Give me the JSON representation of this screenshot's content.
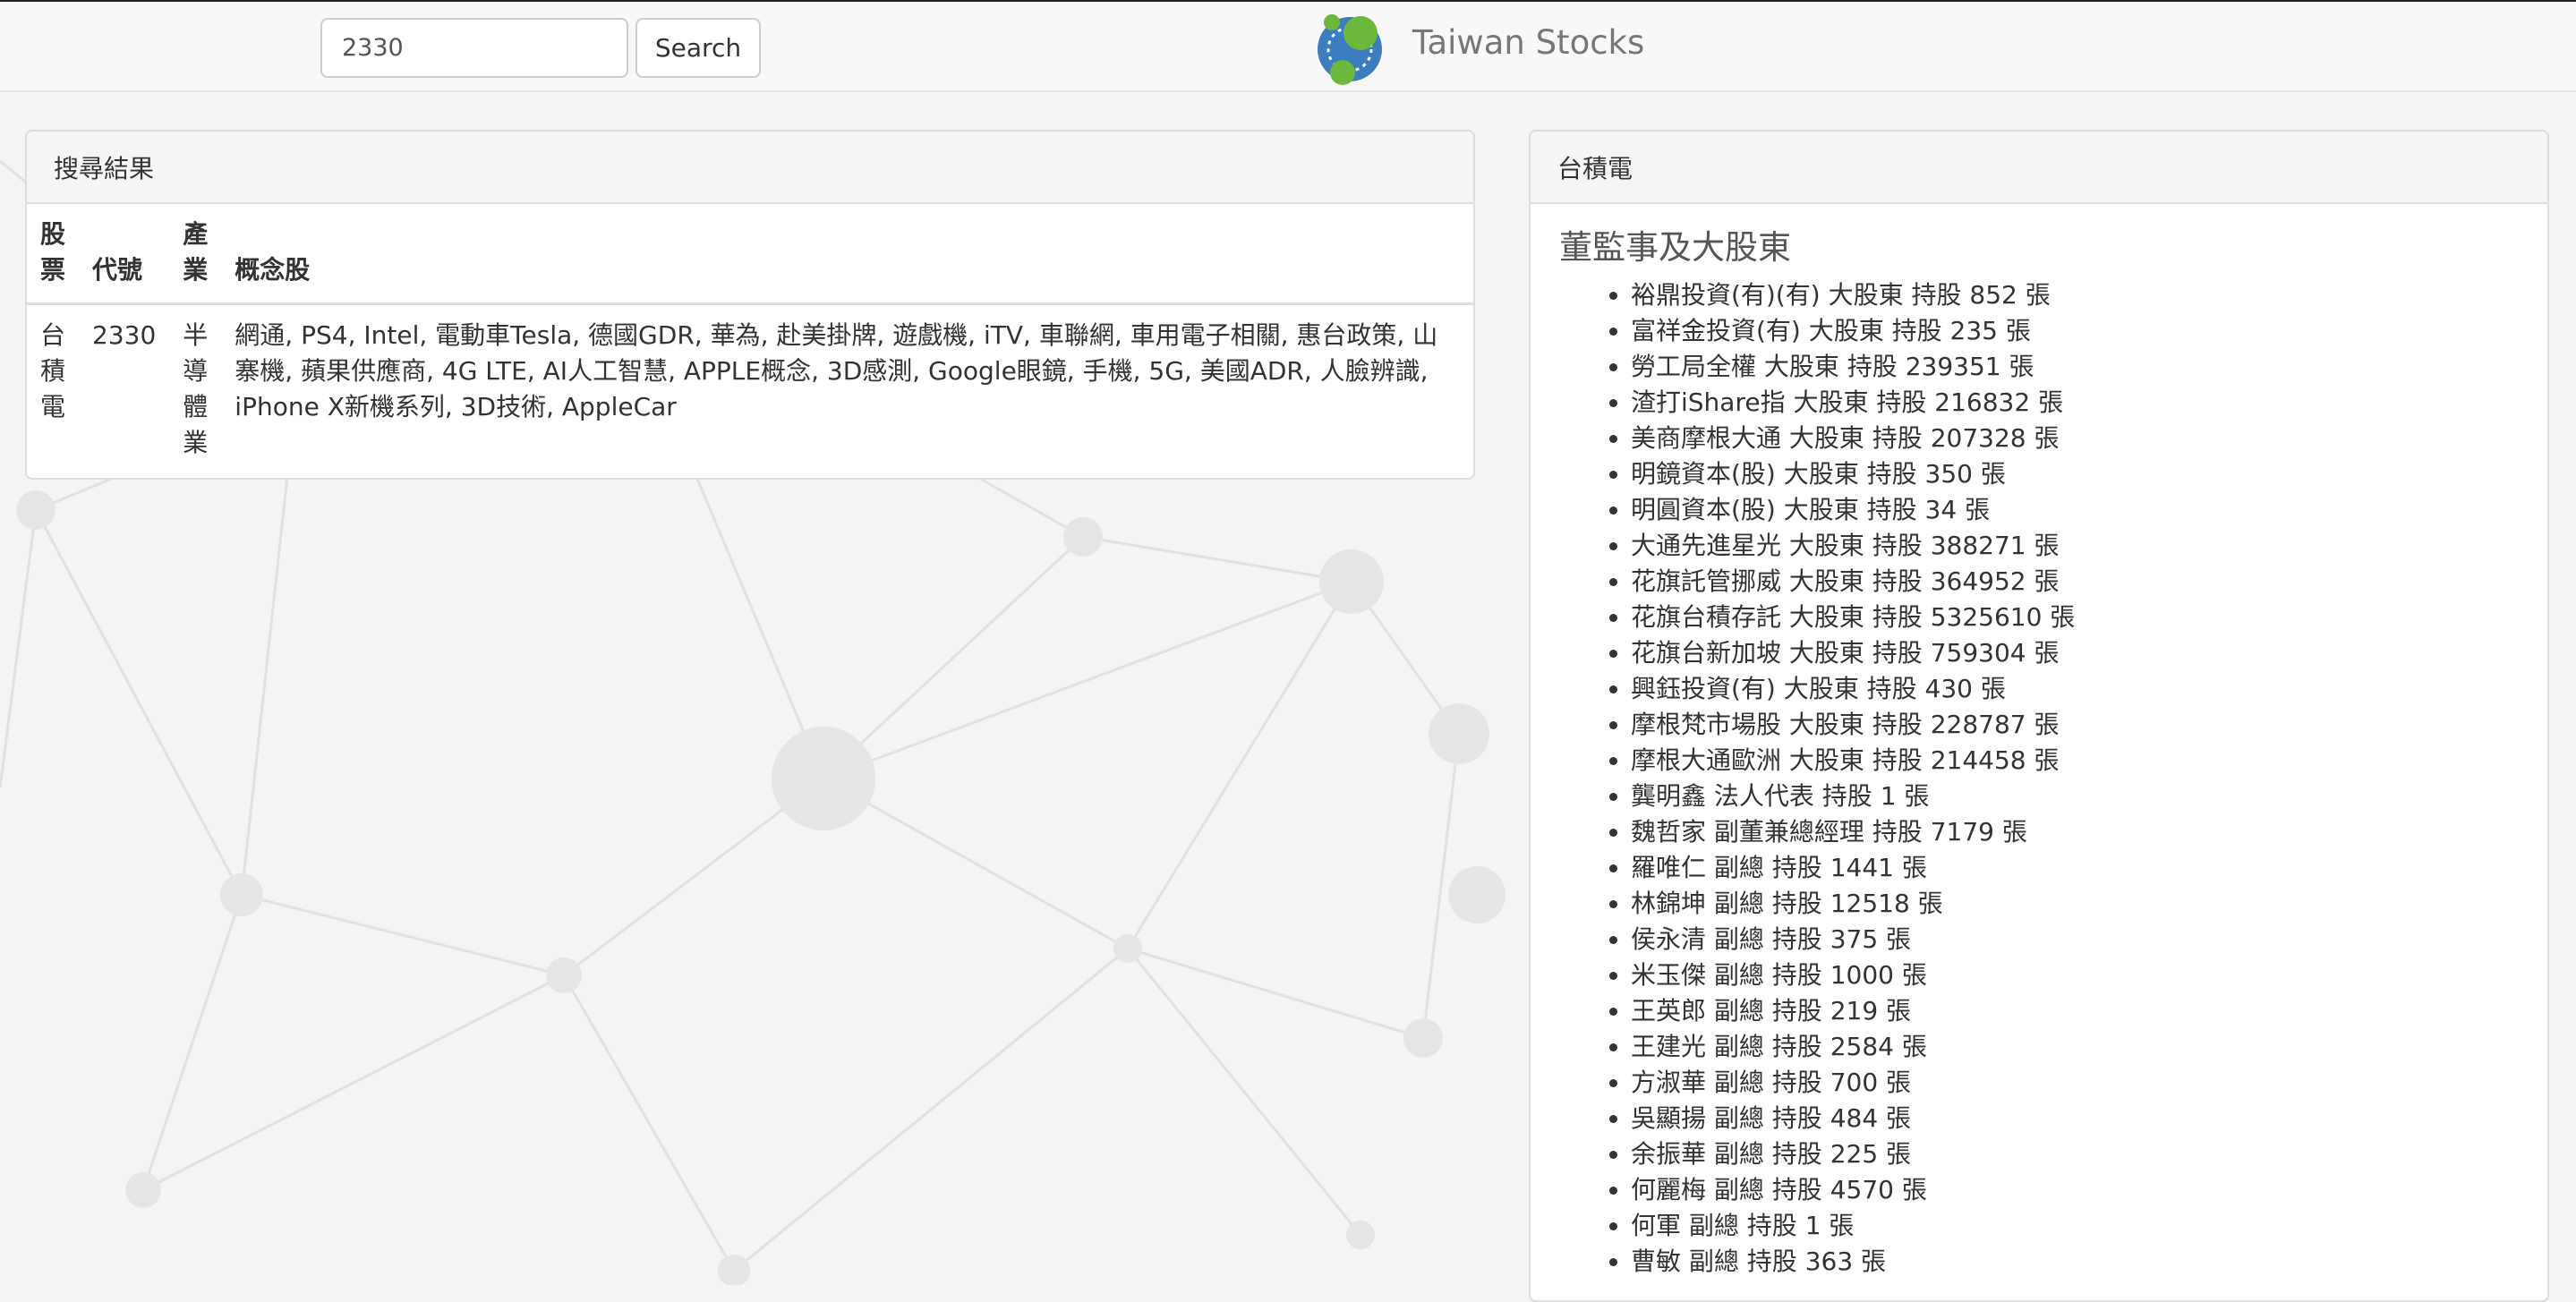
{
  "navbar": {
    "search_value": "2330",
    "search_button": "Search",
    "brand_title": "Taiwan Stocks"
  },
  "results": {
    "heading": "搜尋結果",
    "columns": [
      "股票",
      "代號",
      "產業",
      "概念股"
    ],
    "rows": [
      {
        "name": "台積電",
        "code": "2330",
        "industry": "半導體業",
        "concepts": "網通, PS4, Intel, 電動車Tesla, 德國GDR, 華為, 赴美掛牌, 遊戲機, iTV, 車聯網, 車用電子相關, 惠台政策, 山寨機, 蘋果供應商, 4G LTE, AI人工智慧, APPLE概念, 3D感測, Google眼鏡, 手機, 5G, 美國ADR, 人臉辨識, iPhone X新機系列, 3D技術, AppleCar"
      }
    ]
  },
  "detail": {
    "heading": "台積電",
    "section_title": "董監事及大股東",
    "holders": [
      "裕鼎投資(有)(有) 大股東 持股 852 張",
      "富祥金投資(有) 大股東 持股 235 張",
      "勞工局全權 大股東 持股 239351 張",
      "渣打iShare指 大股東 持股 216832 張",
      "美商摩根大通 大股東 持股 207328 張",
      "明鏡資本(股) 大股東 持股 350 張",
      "明圓資本(股) 大股東 持股 34 張",
      "大通先進星光 大股東 持股 388271 張",
      "花旗託管挪威 大股東 持股 364952 張",
      "花旗台積存託 大股東 持股 5325610 張",
      "花旗台新加坡 大股東 持股 759304 張",
      "興鈺投資(有) 大股東 持股 430 張",
      "摩根梵市場股 大股東 持股 228787 張",
      "摩根大通歐洲 大股東 持股 214458 張",
      "龔明鑫 法人代表 持股 1 張",
      "魏哲家 副董兼總經理 持股 7179 張",
      "羅唯仁 副總 持股 1441 張",
      "林錦坤 副總 持股 12518 張",
      "侯永清 副總 持股 375 張",
      "米玉傑 副總 持股 1000 張",
      "王英郎 副總 持股 219 張",
      "王建光 副總 持股 2584 張",
      "方淑華 副總 持股 700 張",
      "吳顯揚 副總 持股 484 張",
      "余振華 副總 持股 225 張",
      "何麗梅 副總 持股 4570 張",
      "何軍 副總 持股 1 張",
      "曹敏 副總 持股 363 張"
    ]
  }
}
